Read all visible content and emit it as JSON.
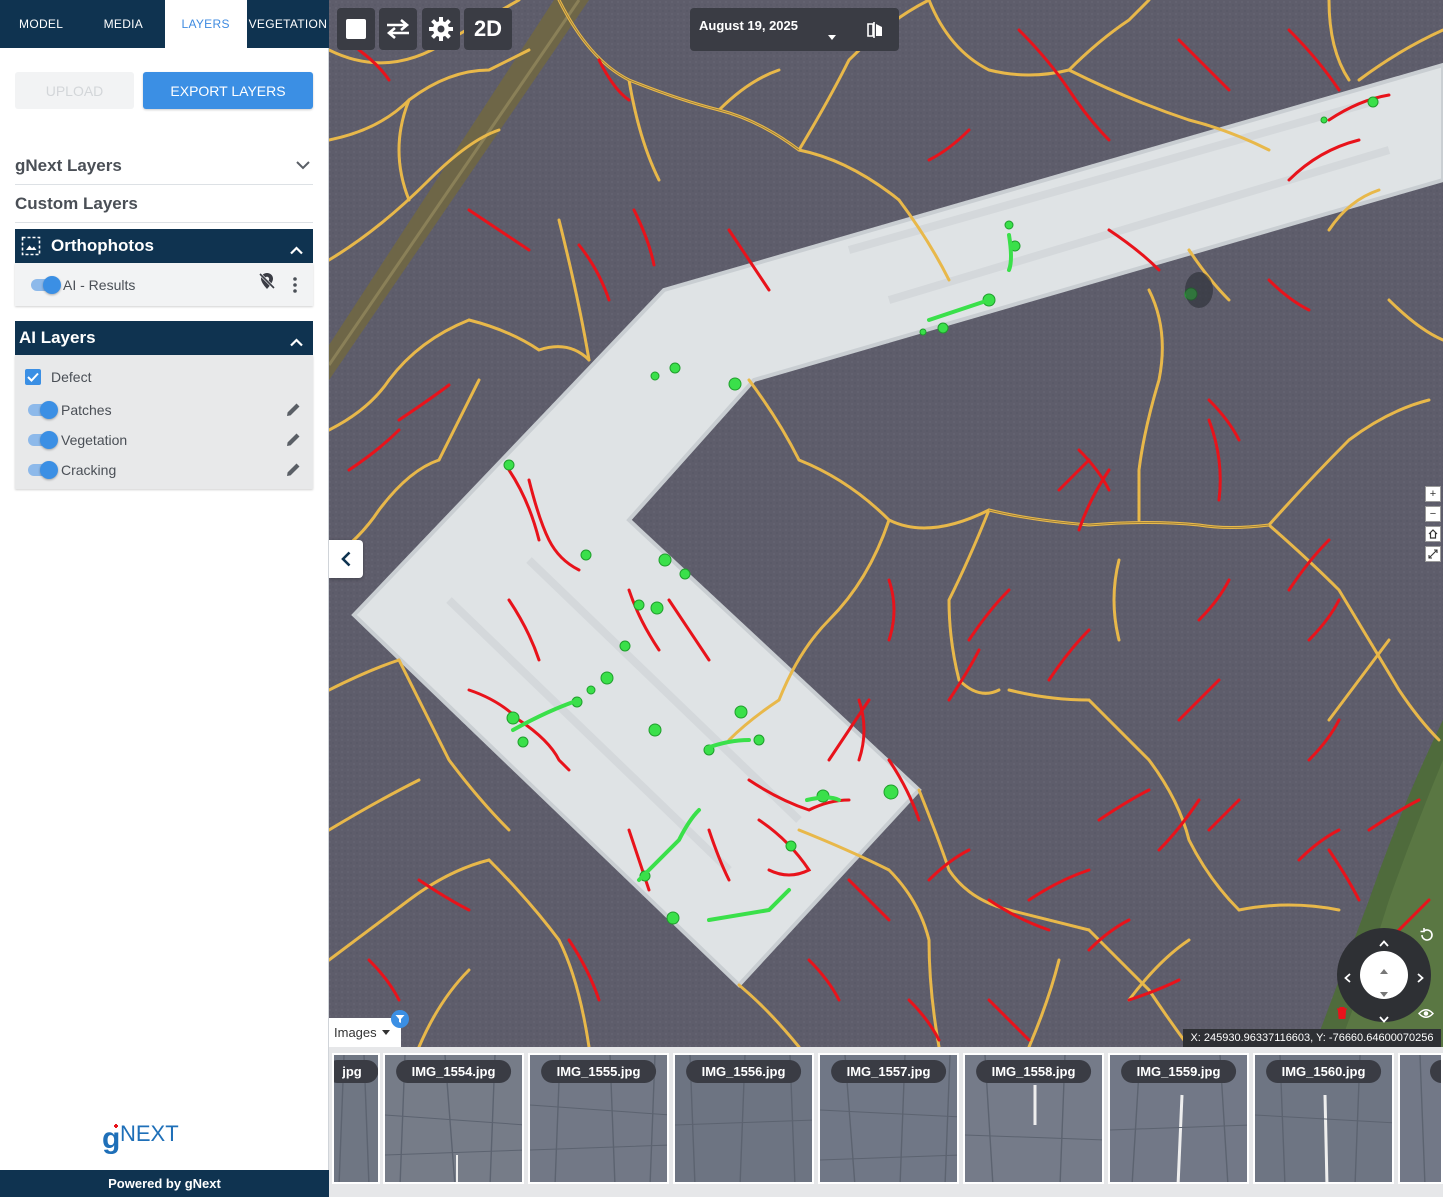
{
  "tabs": [
    {
      "label": "MODEL",
      "active": false
    },
    {
      "label": "MEDIA",
      "active": false
    },
    {
      "label": "LAYERS",
      "active": true
    },
    {
      "label": "VEGETATION",
      "active": false
    }
  ],
  "actions": {
    "upload_label": "UPLOAD",
    "export_label": "EXPORT LAYERS"
  },
  "sections": {
    "gnext_layers": "gNext Layers",
    "custom_layers": "Custom Layers"
  },
  "orthophotos": {
    "title": "Orthophotos",
    "items": [
      {
        "label": "AI - Results",
        "enabled": true
      }
    ]
  },
  "ai_layers": {
    "title": "AI Layers",
    "group_label": "Defect",
    "group_checked": true,
    "items": [
      {
        "label": "Patches",
        "enabled": true
      },
      {
        "label": "Vegetation",
        "enabled": true
      },
      {
        "label": "Cracking",
        "enabled": true
      }
    ]
  },
  "footer": {
    "logo_text": "gNEXT",
    "powered_by": "Powered by gNext"
  },
  "map": {
    "mode_label": "2D",
    "date": "August 19, 2025",
    "coordinates": "X: 245930.96337116603, Y: -76660.64600070256",
    "images_tab": "Images",
    "colors": {
      "cracking": "#e8131b",
      "patches": "#3ae04a",
      "joints": "#e8b84a",
      "pavement": "#5e5d6b"
    }
  },
  "thumbnails": [
    "jpg",
    "IMG_1554.jpg",
    "IMG_1555.jpg",
    "IMG_1556.jpg",
    "IMG_1557.jpg",
    "IMG_1558.jpg",
    "IMG_1559.jpg",
    "IMG_1560.jpg",
    "IM"
  ]
}
